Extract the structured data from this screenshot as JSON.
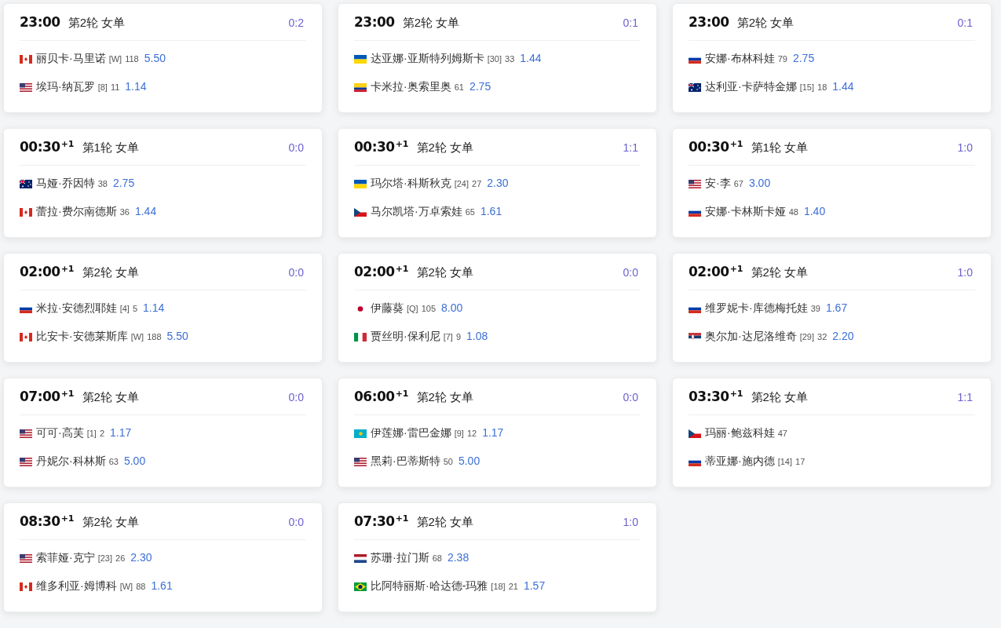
{
  "matches": [
    {
      "time": "23:00",
      "round": "第2轮 女单",
      "score": "0:2",
      "players": [
        {
          "kind": "ca",
          "name": "丽贝卡·马里诺",
          "seed": "[W]",
          "rank": "118",
          "odds": "5.50"
        },
        {
          "kind": "us",
          "name": "埃玛·纳瓦罗",
          "seed": "[8]",
          "rank": "11",
          "odds": "1.14"
        }
      ]
    },
    {
      "time": "23:00",
      "round": "第2轮 女单",
      "score": "0:1",
      "players": [
        {
          "kind": "ua",
          "name": "达亚娜·亚斯特列姆斯卡",
          "seed": "[30]",
          "rank": "33",
          "odds": "1.44"
        },
        {
          "kind": "co",
          "name": "卡米拉·奥索里奥",
          "rank": "61",
          "odds": "2.75"
        }
      ]
    },
    {
      "time": "23:00",
      "round": "第2轮 女单",
      "score": "0:1",
      "players": [
        {
          "kind": "ru",
          "name": "安娜·布林科娃",
          "rank": "79",
          "odds": "2.75"
        },
        {
          "kind": "au",
          "name": "达利亚·卡萨特金娜",
          "seed": "[15]",
          "rank": "18",
          "odds": "1.44"
        }
      ]
    },
    {
      "time": "00:30",
      "day_offset": "+1",
      "round": "第1轮 女单",
      "score": "0:0",
      "players": [
        {
          "kind": "au",
          "name": "马娅·乔因特",
          "rank": "38",
          "odds": "2.75"
        },
        {
          "kind": "ca",
          "name": "蕾拉·费尔南德斯",
          "rank": "36",
          "odds": "1.44"
        }
      ]
    },
    {
      "time": "00:30",
      "day_offset": "+1",
      "round": "第2轮 女单",
      "score": "1:1",
      "players": [
        {
          "kind": "ua",
          "name": "玛尔塔·科斯秋克",
          "seed": "[24]",
          "rank": "27",
          "odds": "2.30"
        },
        {
          "kind": "cz",
          "name": "马尔凯塔·万卓索娃",
          "rank": "65",
          "odds": "1.61"
        }
      ]
    },
    {
      "time": "00:30",
      "day_offset": "+1",
      "round": "第1轮 女单",
      "score": "1:0",
      "players": [
        {
          "kind": "us",
          "name": "安·李",
          "rank": "67",
          "odds": "3.00"
        },
        {
          "kind": "ru",
          "name": "安娜·卡林斯卡娅",
          "rank": "48",
          "odds": "1.40"
        }
      ]
    },
    {
      "time": "02:00",
      "day_offset": "+1",
      "round": "第2轮 女单",
      "score": "0:0",
      "players": [
        {
          "kind": "ru",
          "name": "米拉·安德烈耶娃",
          "seed": "[4]",
          "rank": "5",
          "odds": "1.14"
        },
        {
          "kind": "ca",
          "name": "比安卡·安德莱斯库",
          "seed": "[W]",
          "rank": "188",
          "odds": "5.50"
        }
      ]
    },
    {
      "time": "02:00",
      "day_offset": "+1",
      "round": "第2轮 女单",
      "score": "0:0",
      "players": [
        {
          "kind": "jp",
          "name": "伊藤葵",
          "seed": "[Q]",
          "rank": "105",
          "odds": "8.00"
        },
        {
          "kind": "it",
          "name": "贾丝明·保利尼",
          "seed": "[7]",
          "rank": "9",
          "odds": "1.08"
        }
      ]
    },
    {
      "time": "02:00",
      "day_offset": "+1",
      "round": "第2轮 女单",
      "score": "1:0",
      "players": [
        {
          "kind": "ru",
          "name": "维罗妮卡·库德梅托娃",
          "rank": "39",
          "odds": "1.67"
        },
        {
          "kind": "rs",
          "name": "奥尔加·达尼洛维奇",
          "seed": "[29]",
          "rank": "32",
          "odds": "2.20"
        }
      ]
    },
    {
      "time": "07:00",
      "day_offset": "+1",
      "round": "第2轮 女单",
      "score": "0:0",
      "players": [
        {
          "kind": "us",
          "name": "可可·高芙",
          "seed": "[1]",
          "rank": "2",
          "odds": "1.17"
        },
        {
          "kind": "us",
          "name": "丹妮尔·科林斯",
          "rank": "63",
          "odds": "5.00"
        }
      ]
    },
    {
      "time": "06:00",
      "day_offset": "+1",
      "round": "第2轮 女单",
      "score": "0:0",
      "players": [
        {
          "kind": "kz",
          "name": "伊莲娜·雷巴金娜",
          "seed": "[9]",
          "rank": "12",
          "odds": "1.17"
        },
        {
          "kind": "us",
          "name": "黑莉·巴蒂斯特",
          "rank": "50",
          "odds": "5.00"
        }
      ]
    },
    {
      "time": "03:30",
      "day_offset": "+1",
      "round": "第2轮 女单",
      "score": "1:1",
      "players": [
        {
          "kind": "cz",
          "name": "玛丽·鲍兹科娃",
          "rank": "47"
        },
        {
          "kind": "ru",
          "name": "蒂亚娜·施内德",
          "seed": "[14]",
          "rank": "17"
        }
      ]
    },
    {
      "time": "08:30",
      "day_offset": "+1",
      "round": "第2轮 女单",
      "score": "0:0",
      "players": [
        {
          "kind": "us",
          "name": "索菲娅·克宁",
          "seed": "[23]",
          "rank": "26",
          "odds": "2.30"
        },
        {
          "kind": "ca",
          "name": "维多利亚·姆博科",
          "seed": "[W]",
          "rank": "88",
          "odds": "1.61"
        }
      ]
    },
    {
      "time": "07:30",
      "day_offset": "+1",
      "round": "第2轮 女单",
      "score": "1:0",
      "players": [
        {
          "kind": "nl",
          "name": "苏珊·拉门斯",
          "rank": "68",
          "odds": "2.38"
        },
        {
          "kind": "br",
          "name": "比阿特丽斯·哈达德-玛雅",
          "seed": "[18]",
          "rank": "21",
          "odds": "1.57"
        }
      ]
    }
  ]
}
